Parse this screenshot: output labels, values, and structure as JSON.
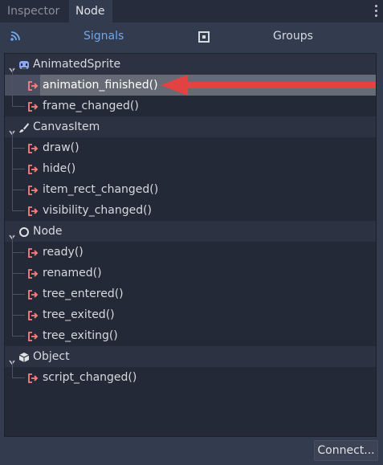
{
  "tabs": [
    {
      "label": "Inspector"
    },
    {
      "label": "Node"
    }
  ],
  "subtabs": {
    "signals_label": "Signals",
    "groups_label": "Groups"
  },
  "tree": {
    "classes": [
      {
        "name": "AnimatedSprite",
        "icon": "animated-sprite-icon",
        "signals": [
          "animation_finished()",
          "frame_changed()"
        ]
      },
      {
        "name": "CanvasItem",
        "icon": "canvas-item-brush-icon",
        "signals": [
          "draw()",
          "hide()",
          "item_rect_changed()",
          "visibility_changed()"
        ]
      },
      {
        "name": "Node",
        "icon": "node-circle-icon",
        "signals": [
          "ready()",
          "renamed()",
          "tree_entered()",
          "tree_exited()",
          "tree_exiting()"
        ]
      },
      {
        "name": "Object",
        "icon": "object-cube-icon",
        "signals": [
          "script_changed()"
        ]
      }
    ],
    "selected_signal": "animation_finished()"
  },
  "buttons": {
    "connect_label": "Connect..."
  },
  "colors": {
    "accent": "#6fa9ec",
    "signal_icon": "#fc7f7f",
    "arrow": "#e34242",
    "panel_bg": "#333b4f",
    "tree_bg": "#232936"
  }
}
